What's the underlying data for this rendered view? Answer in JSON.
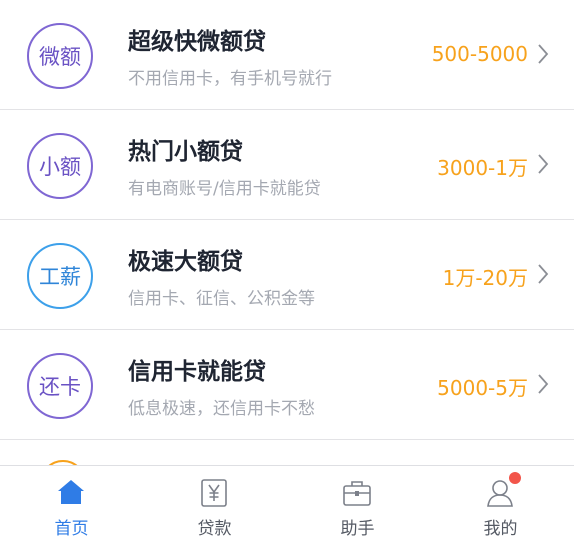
{
  "loans": [
    {
      "badge": "微额",
      "badge_color": "#7f67d3",
      "title": "超级快微额贷",
      "subtitle": "不用信用卡，有手机号就行",
      "range": "500-5000"
    },
    {
      "badge": "小额",
      "badge_color": "#7f67d3",
      "title": "热门小额贷",
      "subtitle": "有电商账号/信用卡就能贷",
      "range": "3000-1万"
    },
    {
      "badge": "工薪",
      "badge_color": "#3da0ea",
      "title": "极速大额贷",
      "subtitle": "信用卡、征信、公积金等",
      "range": "1万-20万"
    },
    {
      "badge": "还卡",
      "badge_color": "#7f67d3",
      "title": "信用卡就能贷",
      "subtitle": "低息极速，还信用卡不愁",
      "range": "5000-5万"
    }
  ],
  "tabs": [
    {
      "label": "首页",
      "icon": "home-icon",
      "active": true
    },
    {
      "label": "贷款",
      "icon": "yen-icon",
      "active": false
    },
    {
      "label": "助手",
      "icon": "briefcase-icon",
      "active": false
    },
    {
      "label": "我的",
      "icon": "user-icon",
      "active": false
    }
  ],
  "colors": {
    "accent": "#2f7ce6",
    "range": "#f7a21c",
    "notify": "#f2554a"
  }
}
